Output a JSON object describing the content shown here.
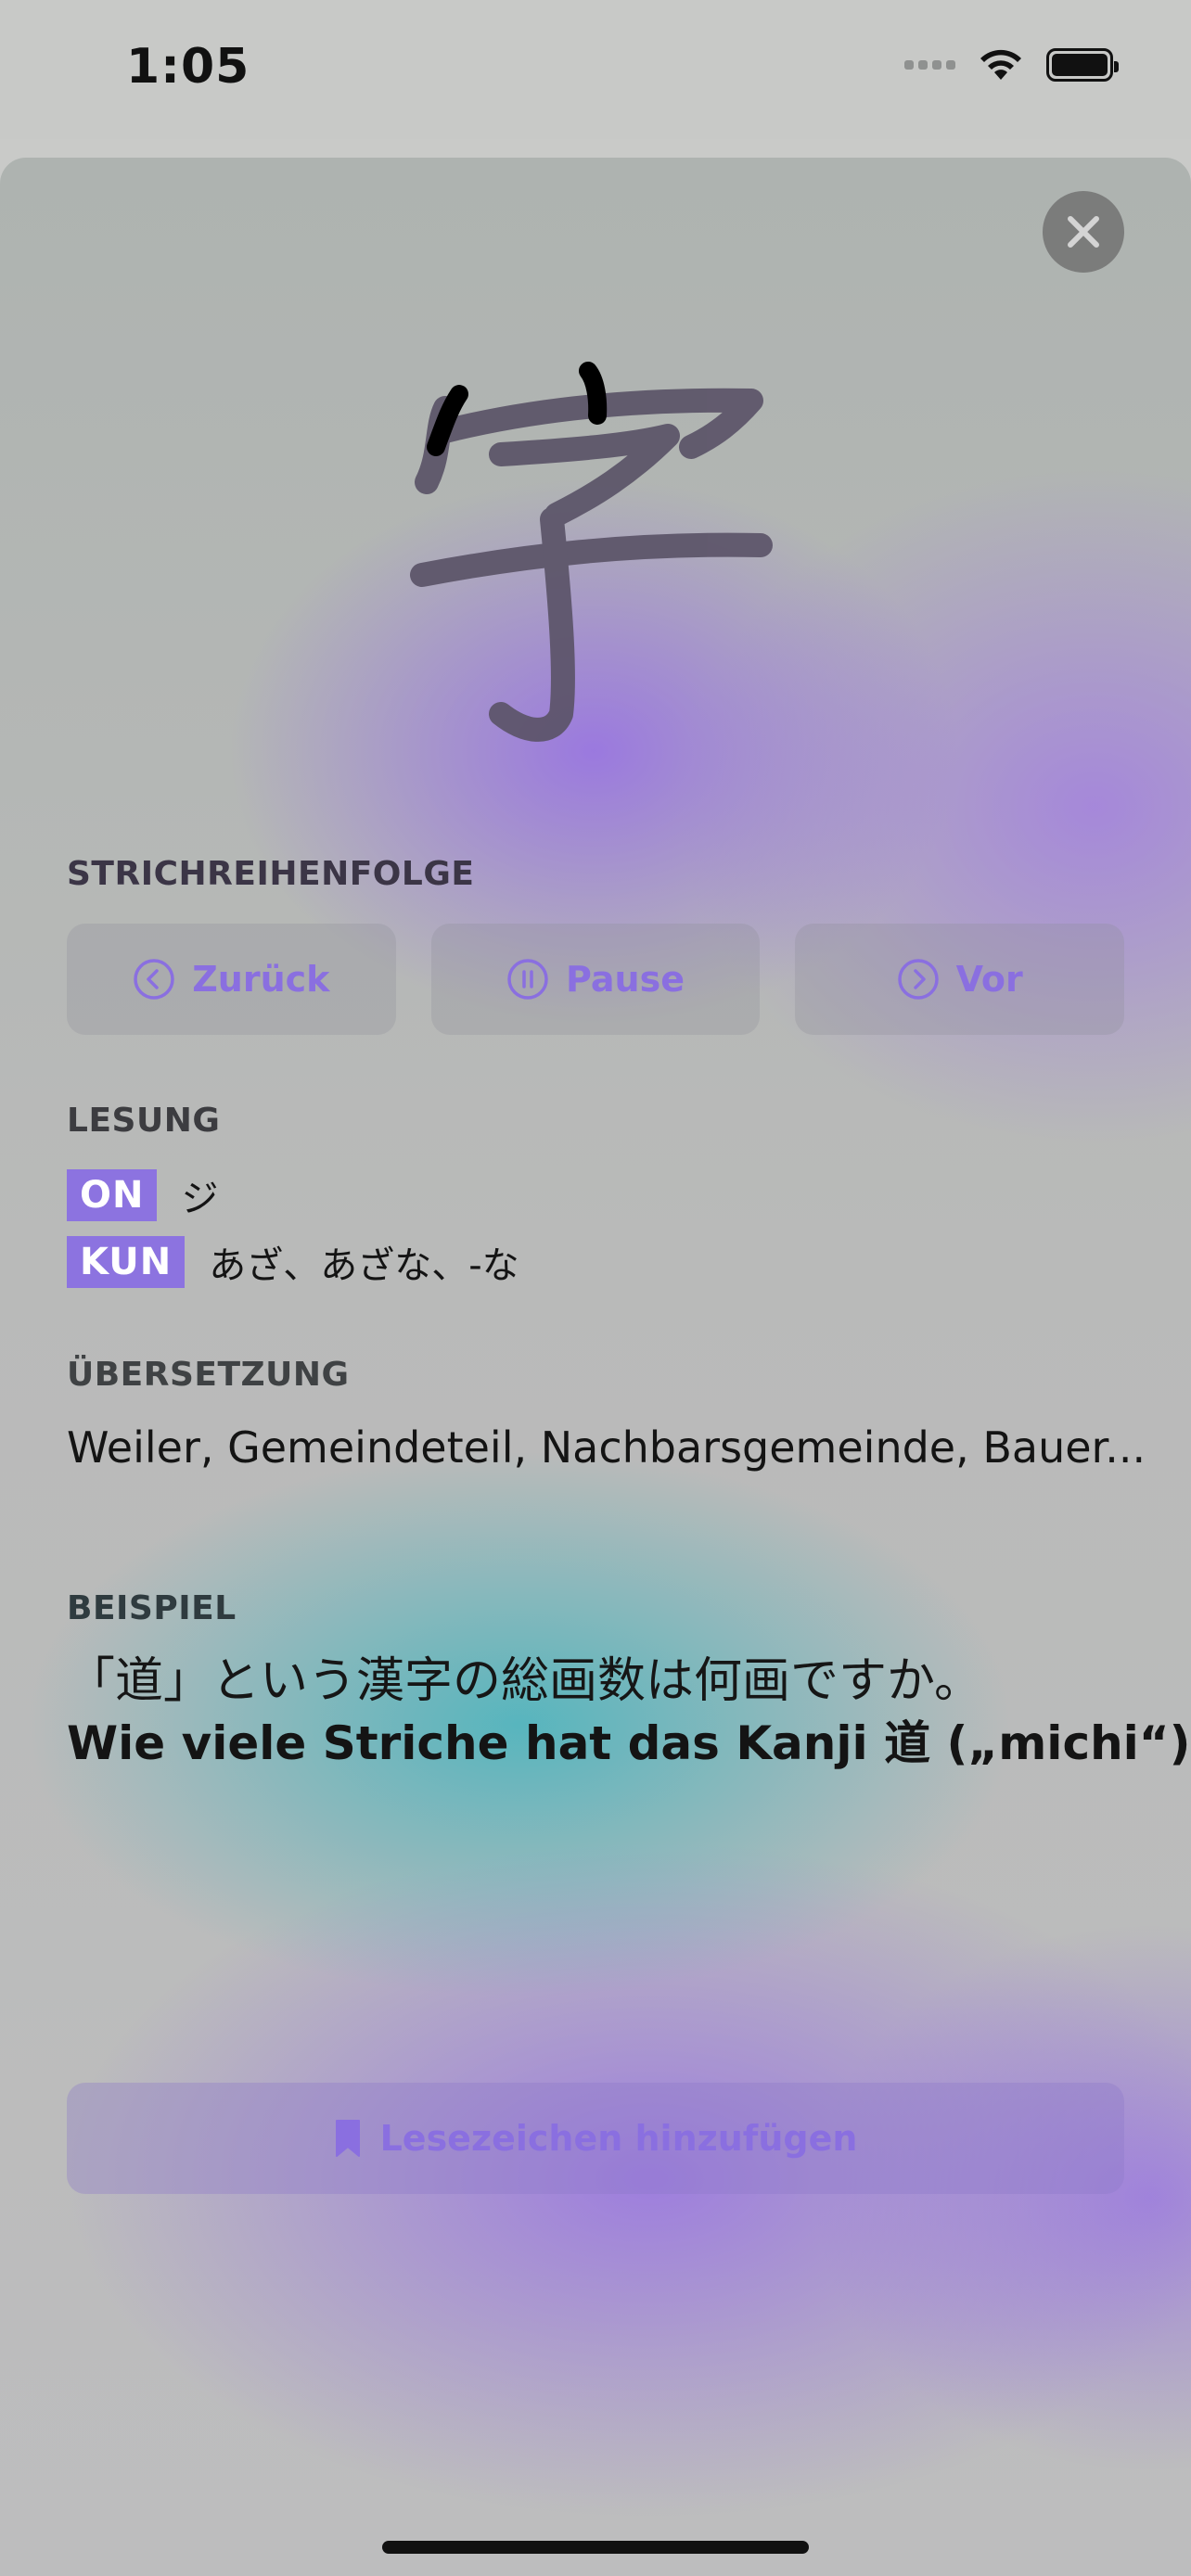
{
  "status_bar": {
    "time": "1:05"
  },
  "kanji": {
    "character": "字"
  },
  "stroke_order": {
    "label": "STRICHREIHENFOLGE",
    "back_label": "Zurück",
    "pause_label": "Pause",
    "forward_label": "Vor"
  },
  "reading": {
    "label": "LESUNG",
    "on_badge": "ON",
    "on_value": "ジ",
    "kun_badge": "KUN",
    "kun_value": "あざ、あざな、-な"
  },
  "translation": {
    "label": "ÜBERSETZUNG",
    "text": "Weiler, Gemeindeteil, Nachbarsgemeinde, Bauer..."
  },
  "example": {
    "label": "BEISPIEL",
    "japanese": "「道」という漢字の総画数は何画ですか。",
    "german": "Wie viele Striche hat das Kanji 道 („michi“)?"
  },
  "bookmark": {
    "label": "Lesezeichen hinzufügen"
  },
  "colors": {
    "accent": "#8c73e0",
    "close_button": "#7b7c7b"
  }
}
